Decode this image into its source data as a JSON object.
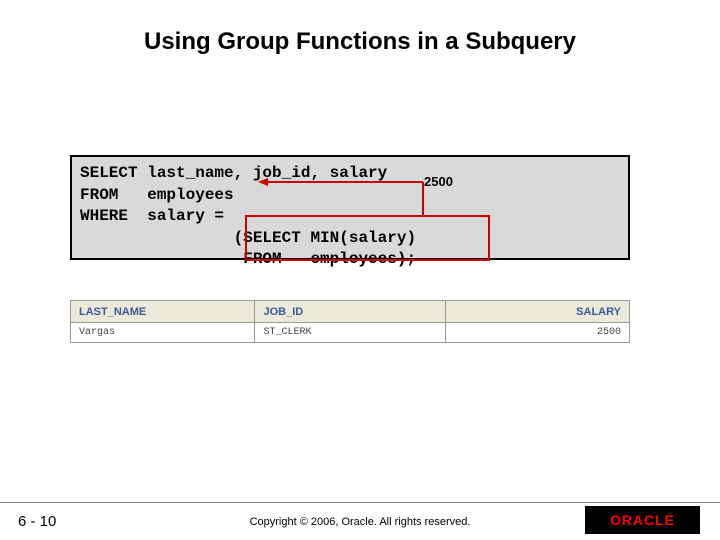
{
  "title": "Using Group Functions in a Subquery",
  "code": {
    "line1": "SELECT last_name, job_id, salary",
    "line2": "FROM   employees",
    "line3": "WHERE  salary =",
    "line4": "                (SELECT MIN(salary)",
    "line5": "                 FROM   employees);"
  },
  "annotation": "2500",
  "table": {
    "headers": {
      "c1": "LAST_NAME",
      "c2": "JOB_ID",
      "c3": "SALARY"
    },
    "row": {
      "c1": "Vargas",
      "c2": "ST_CLERK",
      "c3": "2500"
    }
  },
  "footer": {
    "page": "6 - 10",
    "copyright": "Copyright © 2006, Oracle. All rights reserved.",
    "logo": "ORACLE"
  },
  "chart_data": {
    "type": "table",
    "title": "Using Group Functions in a Subquery",
    "sql": "SELECT last_name, job_id, salary FROM employees WHERE salary = (SELECT MIN(salary) FROM employees);",
    "subquery_result": 2500,
    "columns": [
      "LAST_NAME",
      "JOB_ID",
      "SALARY"
    ],
    "rows": [
      [
        "Vargas",
        "ST_CLERK",
        2500
      ]
    ]
  }
}
